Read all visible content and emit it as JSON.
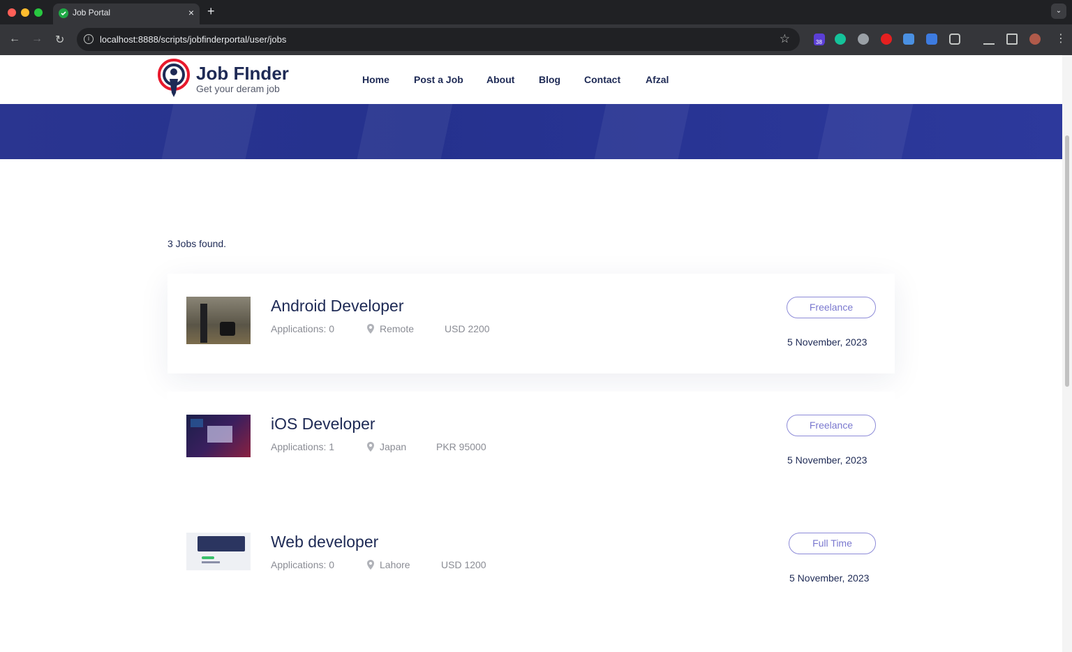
{
  "browser": {
    "tab_title": "Job Portal",
    "tab_close": "×",
    "new_tab": "+",
    "url": "localhost:8888/scripts/jobfinderportal/user/jobs",
    "extension_badge": "38"
  },
  "site": {
    "brand": "Job FInder",
    "tagline": "Get your deram job",
    "nav": [
      "Home",
      "Post a Job",
      "About",
      "Blog",
      "Contact",
      "Afzal"
    ],
    "accent_color": "#2a3590",
    "text_color": "#1e2a55"
  },
  "results": {
    "count_text": "3 Jobs found."
  },
  "jobs": [
    {
      "title": "Android Developer",
      "applications": "Applications: 0",
      "location": "Remote",
      "salary": "USD 2200",
      "type": "Freelance",
      "date": "5 November, 2023"
    },
    {
      "title": "iOS Developer",
      "applications": "Applications: 1",
      "location": "Japan",
      "salary": "PKR 95000",
      "type": "Freelance",
      "date": "5 November, 2023"
    },
    {
      "title": "Web developer",
      "applications": "Applications: 0",
      "location": "Lahore",
      "salary": "USD 1200",
      "type": "Full Time",
      "date": "5 November, 2023"
    }
  ]
}
